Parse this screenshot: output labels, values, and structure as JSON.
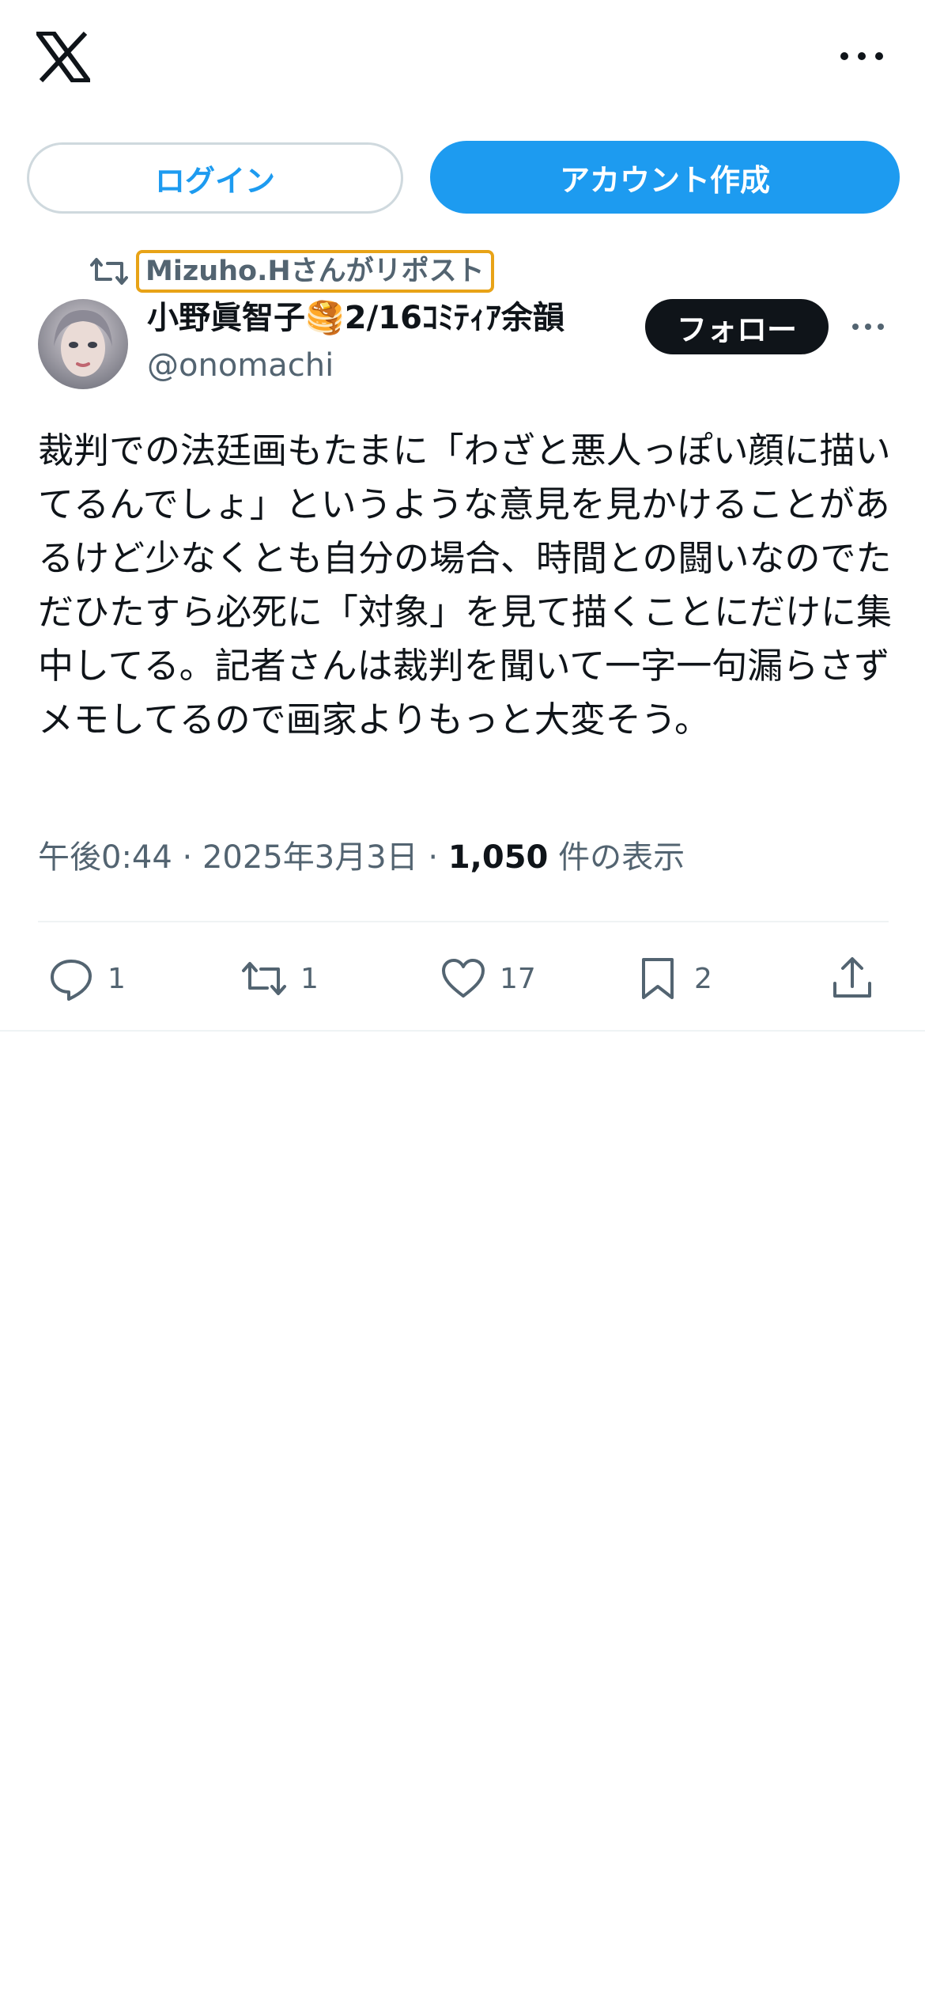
{
  "header": {
    "logo_icon": "x-logo-icon",
    "more_icon": "more-horizontal-icon"
  },
  "auth": {
    "login_label": "ログイン",
    "signup_label": "アカウント作成"
  },
  "repost": {
    "icon": "repost-icon",
    "label": "Mizuho.Hさんがリポスト"
  },
  "post": {
    "author": {
      "display_name": "小野眞智子🥞2/16ｺﾐﾃｨｱ余韻",
      "handle": "@onomachi"
    },
    "follow_label": "フォロー",
    "text": "裁判での法廷画もたまに「わざと悪人っぽい顔に描いてるんでしょ」というような意見を見かけることがあるけど少なくとも自分の場合、時間との闘いなのでただひたすら必死に「対象」を見て描くことにだけに集中してる。記者さんは裁判を聞いて一字一句漏らさずメモしてるので画家よりもっと大変そう。",
    "time": "午後0:44",
    "date": "2025年3月3日",
    "separator": "·",
    "views_count": "1,050",
    "views_label": "件の表示"
  },
  "actions": {
    "reply_count": "1",
    "repost_count": "1",
    "like_count": "17",
    "bookmark_count": "2"
  },
  "colors": {
    "accent": "#1d9bf0",
    "text_primary": "#0f1419",
    "text_secondary": "#536471",
    "highlight_border": "#e8a317"
  }
}
